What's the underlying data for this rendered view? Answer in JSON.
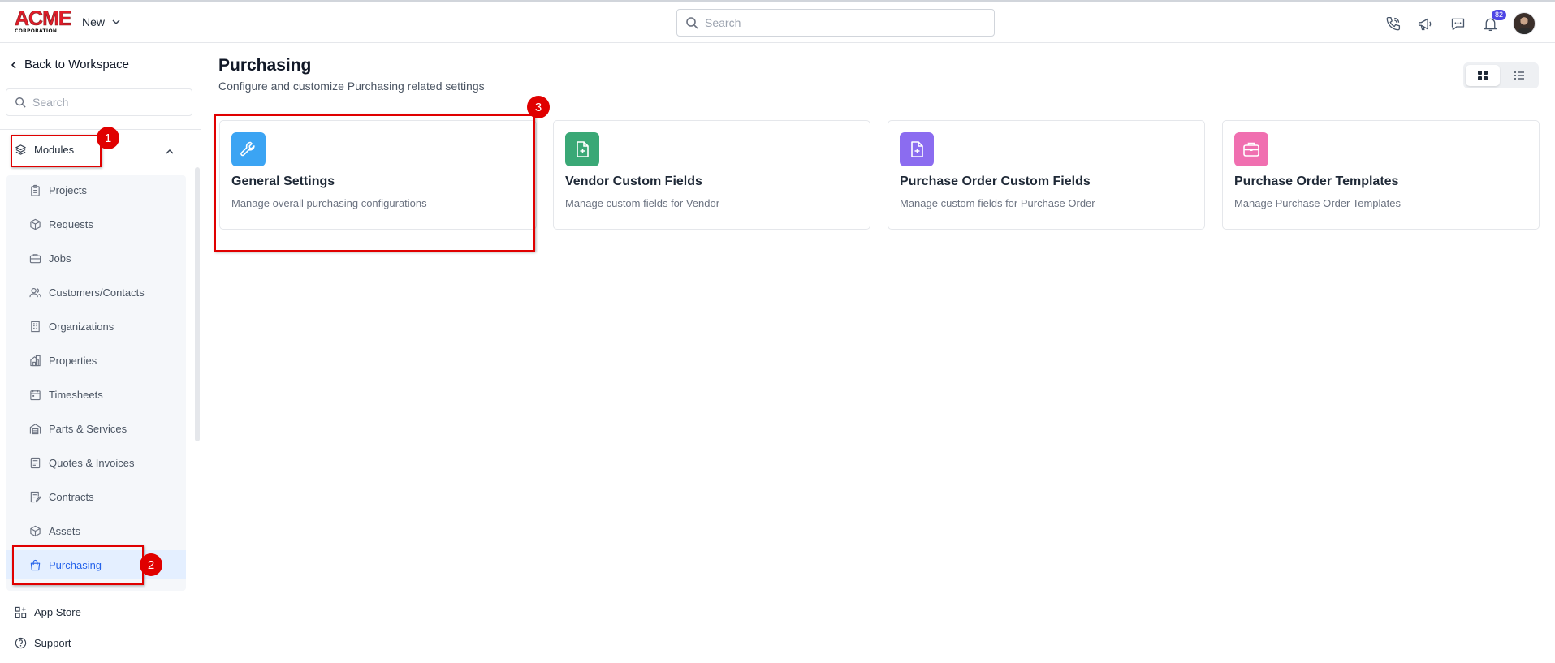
{
  "header": {
    "logo_text": "ACME",
    "logo_subtext": "CORPORATION",
    "new_label": "New",
    "search_placeholder": "Search",
    "notification_count": "82"
  },
  "sidebar": {
    "back_label": "Back to Workspace",
    "search_placeholder": "Search",
    "modules_label": "Modules",
    "items": [
      {
        "label": "Projects",
        "icon": "clipboard-icon"
      },
      {
        "label": "Requests",
        "icon": "box-icon"
      },
      {
        "label": "Jobs",
        "icon": "briefcase-icon"
      },
      {
        "label": "Customers/Contacts",
        "icon": "users-icon"
      },
      {
        "label": "Organizations",
        "icon": "building-icon"
      },
      {
        "label": "Properties",
        "icon": "property-icon"
      },
      {
        "label": "Timesheets",
        "icon": "calendar-icon"
      },
      {
        "label": "Parts & Services",
        "icon": "warehouse-icon"
      },
      {
        "label": "Quotes & Invoices",
        "icon": "invoice-icon"
      },
      {
        "label": "Contracts",
        "icon": "contract-icon"
      },
      {
        "label": "Assets",
        "icon": "cube-icon"
      },
      {
        "label": "Purchasing",
        "icon": "shopping-bag-icon",
        "active": true
      }
    ],
    "app_store_label": "App Store",
    "support_label": "Support"
  },
  "main": {
    "title": "Purchasing",
    "subtitle": "Configure and customize Purchasing related settings",
    "cards": [
      {
        "title": "General Settings",
        "description": "Manage overall purchasing configurations",
        "icon": "wrench-icon",
        "color": "#3ba4f3"
      },
      {
        "title": "Vendor Custom Fields",
        "description": "Manage custom fields for Vendor",
        "icon": "file-plus-icon",
        "color": "#3aa876"
      },
      {
        "title": "Purchase Order Custom Fields",
        "description": "Manage custom fields for Purchase Order",
        "icon": "file-plus-icon",
        "color": "#8b6cf0"
      },
      {
        "title": "Purchase Order Templates",
        "description": "Manage Purchase Order Templates",
        "icon": "briefcase-icon",
        "color": "#f06fb0"
      }
    ]
  },
  "annotations": [
    "1",
    "2",
    "3"
  ],
  "colors": {
    "accent": "#2563eb",
    "annotation_red": "#e00000",
    "active_bg": "#e4efff"
  }
}
